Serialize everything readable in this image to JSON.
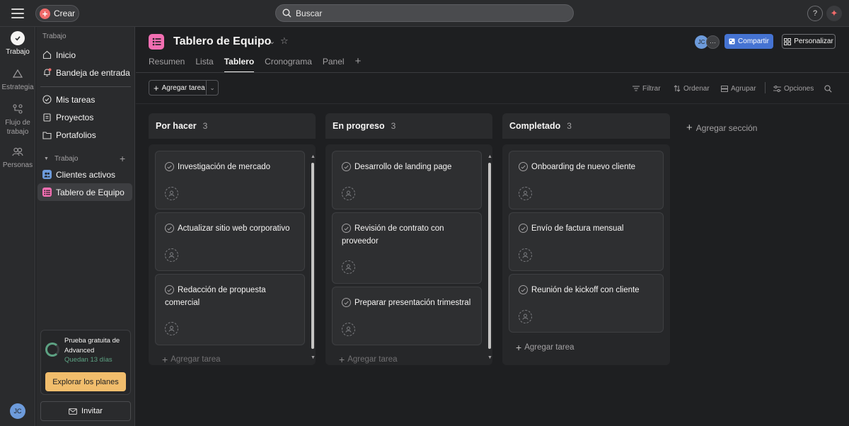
{
  "topbar": {
    "create_label": "Crear",
    "search_placeholder": "Buscar",
    "help_label": "?"
  },
  "rail": {
    "items": [
      {
        "label": "Trabajo",
        "icon": "check-circle-icon"
      },
      {
        "label": "Estrategia",
        "icon": "triangle-icon"
      },
      {
        "label": "Flujo de trabajo",
        "icon": "workflow-icon"
      },
      {
        "label": "Personas",
        "icon": "people-icon"
      }
    ],
    "avatar_initials": "JC"
  },
  "sidebar": {
    "section_title": "Trabajo",
    "items": [
      {
        "label": "Inicio",
        "icon": "home-icon"
      },
      {
        "label": "Bandeja de entrada",
        "icon": "bell-icon"
      },
      {
        "label": "Mis tareas",
        "icon": "check-circle-icon"
      },
      {
        "label": "Proyectos",
        "icon": "clipboard-icon"
      },
      {
        "label": "Portafolios",
        "icon": "folder-icon"
      }
    ],
    "team_section": "Trabajo",
    "projects": [
      {
        "label": "Clientes activos",
        "color": "#6d9bdb"
      },
      {
        "label": "Tablero de Equipo",
        "color": "#f26fb2"
      }
    ],
    "trial": {
      "title": "Prueba gratuita de Advanced",
      "remaining": "Quedan 13 días",
      "cta": "Explorar los planes"
    },
    "invite_label": "Invitar"
  },
  "project": {
    "title": "Tablero de Equipo",
    "avatar_initials": "JC",
    "more_label": "···",
    "share_label": "Compartir",
    "customize_label": "Personalizar",
    "tabs": [
      "Resumen",
      "Lista",
      "Tablero",
      "Cronograma",
      "Panel"
    ],
    "active_tab": "Tablero",
    "tab_add": "+"
  },
  "toolbar": {
    "add_task_label": "Agregar tarea",
    "filter_label": "Filtrar",
    "sort_label": "Ordenar",
    "group_label": "Agrupar",
    "options_label": "Opciones"
  },
  "board": {
    "columns": [
      {
        "name": "Por hacer",
        "count": "3",
        "cards": [
          {
            "title": "Investigación de mercado"
          },
          {
            "title": "Actualizar sitio web corporativo"
          },
          {
            "title": "Redacción de propuesta comercial"
          }
        ],
        "add_label": "Agregar tarea"
      },
      {
        "name": "En progreso",
        "count": "3",
        "cards": [
          {
            "title": "Desarrollo de landing page"
          },
          {
            "title": "Revisión de contrato con proveedor"
          },
          {
            "title": "Preparar presentación trimestral"
          }
        ],
        "add_label": "Agregar tarea"
      },
      {
        "name": "Completado",
        "count": "3",
        "cards": [
          {
            "title": "Onboarding de nuevo cliente"
          },
          {
            "title": "Envío de factura mensual"
          },
          {
            "title": "Reunión de kickoff con cliente"
          }
        ],
        "add_label": "Agregar tarea"
      }
    ],
    "add_section_label": "Agregar sección"
  },
  "colors": {
    "accent": "#4573d2",
    "create": "#f06a6a",
    "project_pink": "#f26fb2",
    "trial_green": "#5da283",
    "trial_cta": "#f1bd6c"
  }
}
